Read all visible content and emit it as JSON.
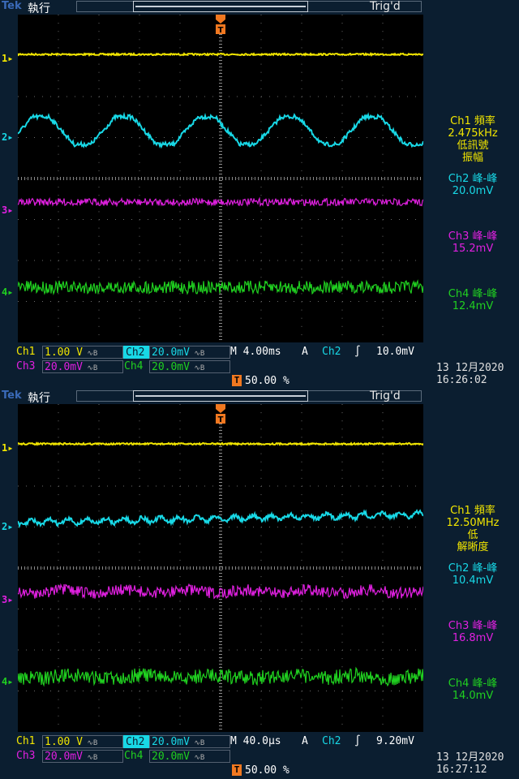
{
  "colors": {
    "ch1": "#f2e600",
    "ch2": "#18d8e6",
    "ch3": "#e020e0",
    "ch4": "#20d020",
    "trigger": "#f07820",
    "text": "#ffffff",
    "background": "#0b1e30",
    "graticule": "#000000"
  },
  "screens": [
    {
      "brand": "Tek",
      "run_state": "執行",
      "trig_state": "Trig'd",
      "channel_markers": [
        "1",
        "2",
        "3",
        "4"
      ],
      "readouts": {
        "ch1_lines": [
          "Ch1 頻率",
          "2.475kHz",
          "低訊號",
          "振幅"
        ],
        "ch2_label": "Ch2 峰-峰",
        "ch2_value": "20.0mV",
        "ch3_label": "Ch3 峰-峰",
        "ch3_value": "15.2mV",
        "ch4_label": "Ch4 峰-峰",
        "ch4_value": "12.4mV"
      },
      "status": {
        "ch1_name": "Ch1",
        "ch1_scale": "1.00 V",
        "ch2_name": "Ch2",
        "ch2_scale": "20.0mV",
        "ch3_name": "Ch3",
        "ch3_scale": "20.0mV",
        "ch4_name": "Ch4",
        "ch4_scale": "20.0mV",
        "timebase": "M 4.00ms",
        "trig_mode": "A",
        "trig_source": "Ch2",
        "trig_slope": "∫",
        "trig_level": "10.0mV",
        "trig_position": "50.00 %",
        "date": "13 12月2020",
        "time": "16:26:02"
      },
      "waveform": {
        "ch2_type": "trapezoid",
        "ch2_cycles": 4.9
      }
    },
    {
      "brand": "Tek",
      "run_state": "執行",
      "trig_state": "Trig'd",
      "channel_markers": [
        "1",
        "2",
        "3",
        "4"
      ],
      "readouts": {
        "ch1_lines": [
          "Ch1 頻率",
          "12.50MHz",
          "低",
          "解晰度"
        ],
        "ch2_label": "Ch2 峰-峰",
        "ch2_value": "10.4mV",
        "ch3_label": "Ch3 峰-峰",
        "ch3_value": "16.8mV",
        "ch4_label": "Ch4 峰-峰",
        "ch4_value": "14.0mV"
      },
      "status": {
        "ch1_name": "Ch1",
        "ch1_scale": "1.00 V",
        "ch2_name": "Ch2",
        "ch2_scale": "20.0mV",
        "ch3_name": "Ch3",
        "ch3_scale": "20.0mV",
        "ch4_name": "Ch4",
        "ch4_scale": "20.0mV",
        "timebase": "M 40.0µs",
        "trig_mode": "A",
        "trig_source": "Ch2",
        "trig_slope": "∫",
        "trig_level": "9.20mV",
        "trig_position": "50.00 %",
        "date": "13 12月2020",
        "time": "16:27:12"
      },
      "waveform": {
        "ch2_type": "noisy-ripple",
        "ch2_cycles": 22
      }
    }
  ]
}
